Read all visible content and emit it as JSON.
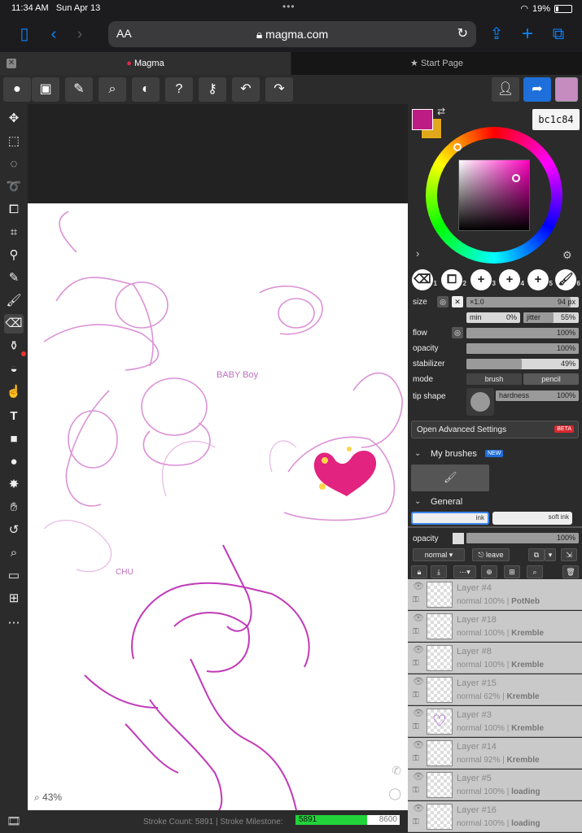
{
  "status_bar": {
    "time": "11:34 AM",
    "date": "Sun Apr 13",
    "battery": "19%",
    "battery_level": 0.19
  },
  "browser": {
    "aa": "AA",
    "url": "magma.com"
  },
  "tabs": [
    {
      "label": "Magma"
    },
    {
      "label": "Start Page"
    }
  ],
  "color": {
    "hex_label": "bc1c84",
    "primary": "#bc1c84",
    "secondary": "#e0a81a"
  },
  "brush_slots": [
    "1",
    "2",
    "3",
    "4",
    "5",
    "6"
  ],
  "brush": {
    "size_label": "size",
    "size_mult": "×1.0",
    "size_value": "94 px",
    "min_label": "min",
    "min_value": "0%",
    "jitter_label": "jitter",
    "jitter_value": "55%",
    "flow_label": "flow",
    "flow_value": "100%",
    "opacity_label": "opacity",
    "opacity_value": "100%",
    "stabilizer_label": "stabilizer",
    "stabilizer_value": "49%",
    "stabilizer_level": 0.49,
    "mode_label": "mode",
    "mode_brush": "brush",
    "mode_pencil": "pencil",
    "tip_label": "tip shape",
    "hardness_label": "hardness",
    "hardness_value": "100%",
    "advanced": "Open Advanced Settings",
    "beta": "BETA"
  },
  "brush_sections": {
    "my_brushes": "My brushes",
    "new_badge": "NEW",
    "general": "General",
    "ink": "ink",
    "soft_ink": "soft ink"
  },
  "layers_panel": {
    "opacity_label": "opacity",
    "opacity_value": "100%",
    "blend": "normal",
    "leave": "leave"
  },
  "layers": [
    {
      "name": "Layer #4",
      "mode": "normal",
      "opacity": "100%",
      "owner": "PotNeb"
    },
    {
      "name": "Layer #18",
      "mode": "normal",
      "opacity": "100%",
      "owner": "Kremble"
    },
    {
      "name": "Layer #8",
      "mode": "normal",
      "opacity": "100%",
      "owner": "Kremble"
    },
    {
      "name": "Layer #15",
      "mode": "normal",
      "opacity": "62%",
      "owner": "Kremble"
    },
    {
      "name": "Layer #3",
      "mode": "normal",
      "opacity": "100%",
      "owner": "Kremble"
    },
    {
      "name": "Layer #14",
      "mode": "normal",
      "opacity": "92%",
      "owner": "Kremble"
    },
    {
      "name": "Layer #5",
      "mode": "normal",
      "opacity": "100%",
      "owner": "loading"
    },
    {
      "name": "Layer #16",
      "mode": "normal",
      "opacity": "100%",
      "owner": "loading"
    }
  ],
  "canvas": {
    "zoom": "43%",
    "sketch_text_1": "BABY Boy",
    "sketch_text_2": "CHU"
  },
  "stats": {
    "stroke_count_label": "Stroke Count: 5891 | Stroke Milestone:",
    "stroke_current": "5891",
    "stroke_milestone": "8600",
    "milestone_fraction": 0.685
  }
}
